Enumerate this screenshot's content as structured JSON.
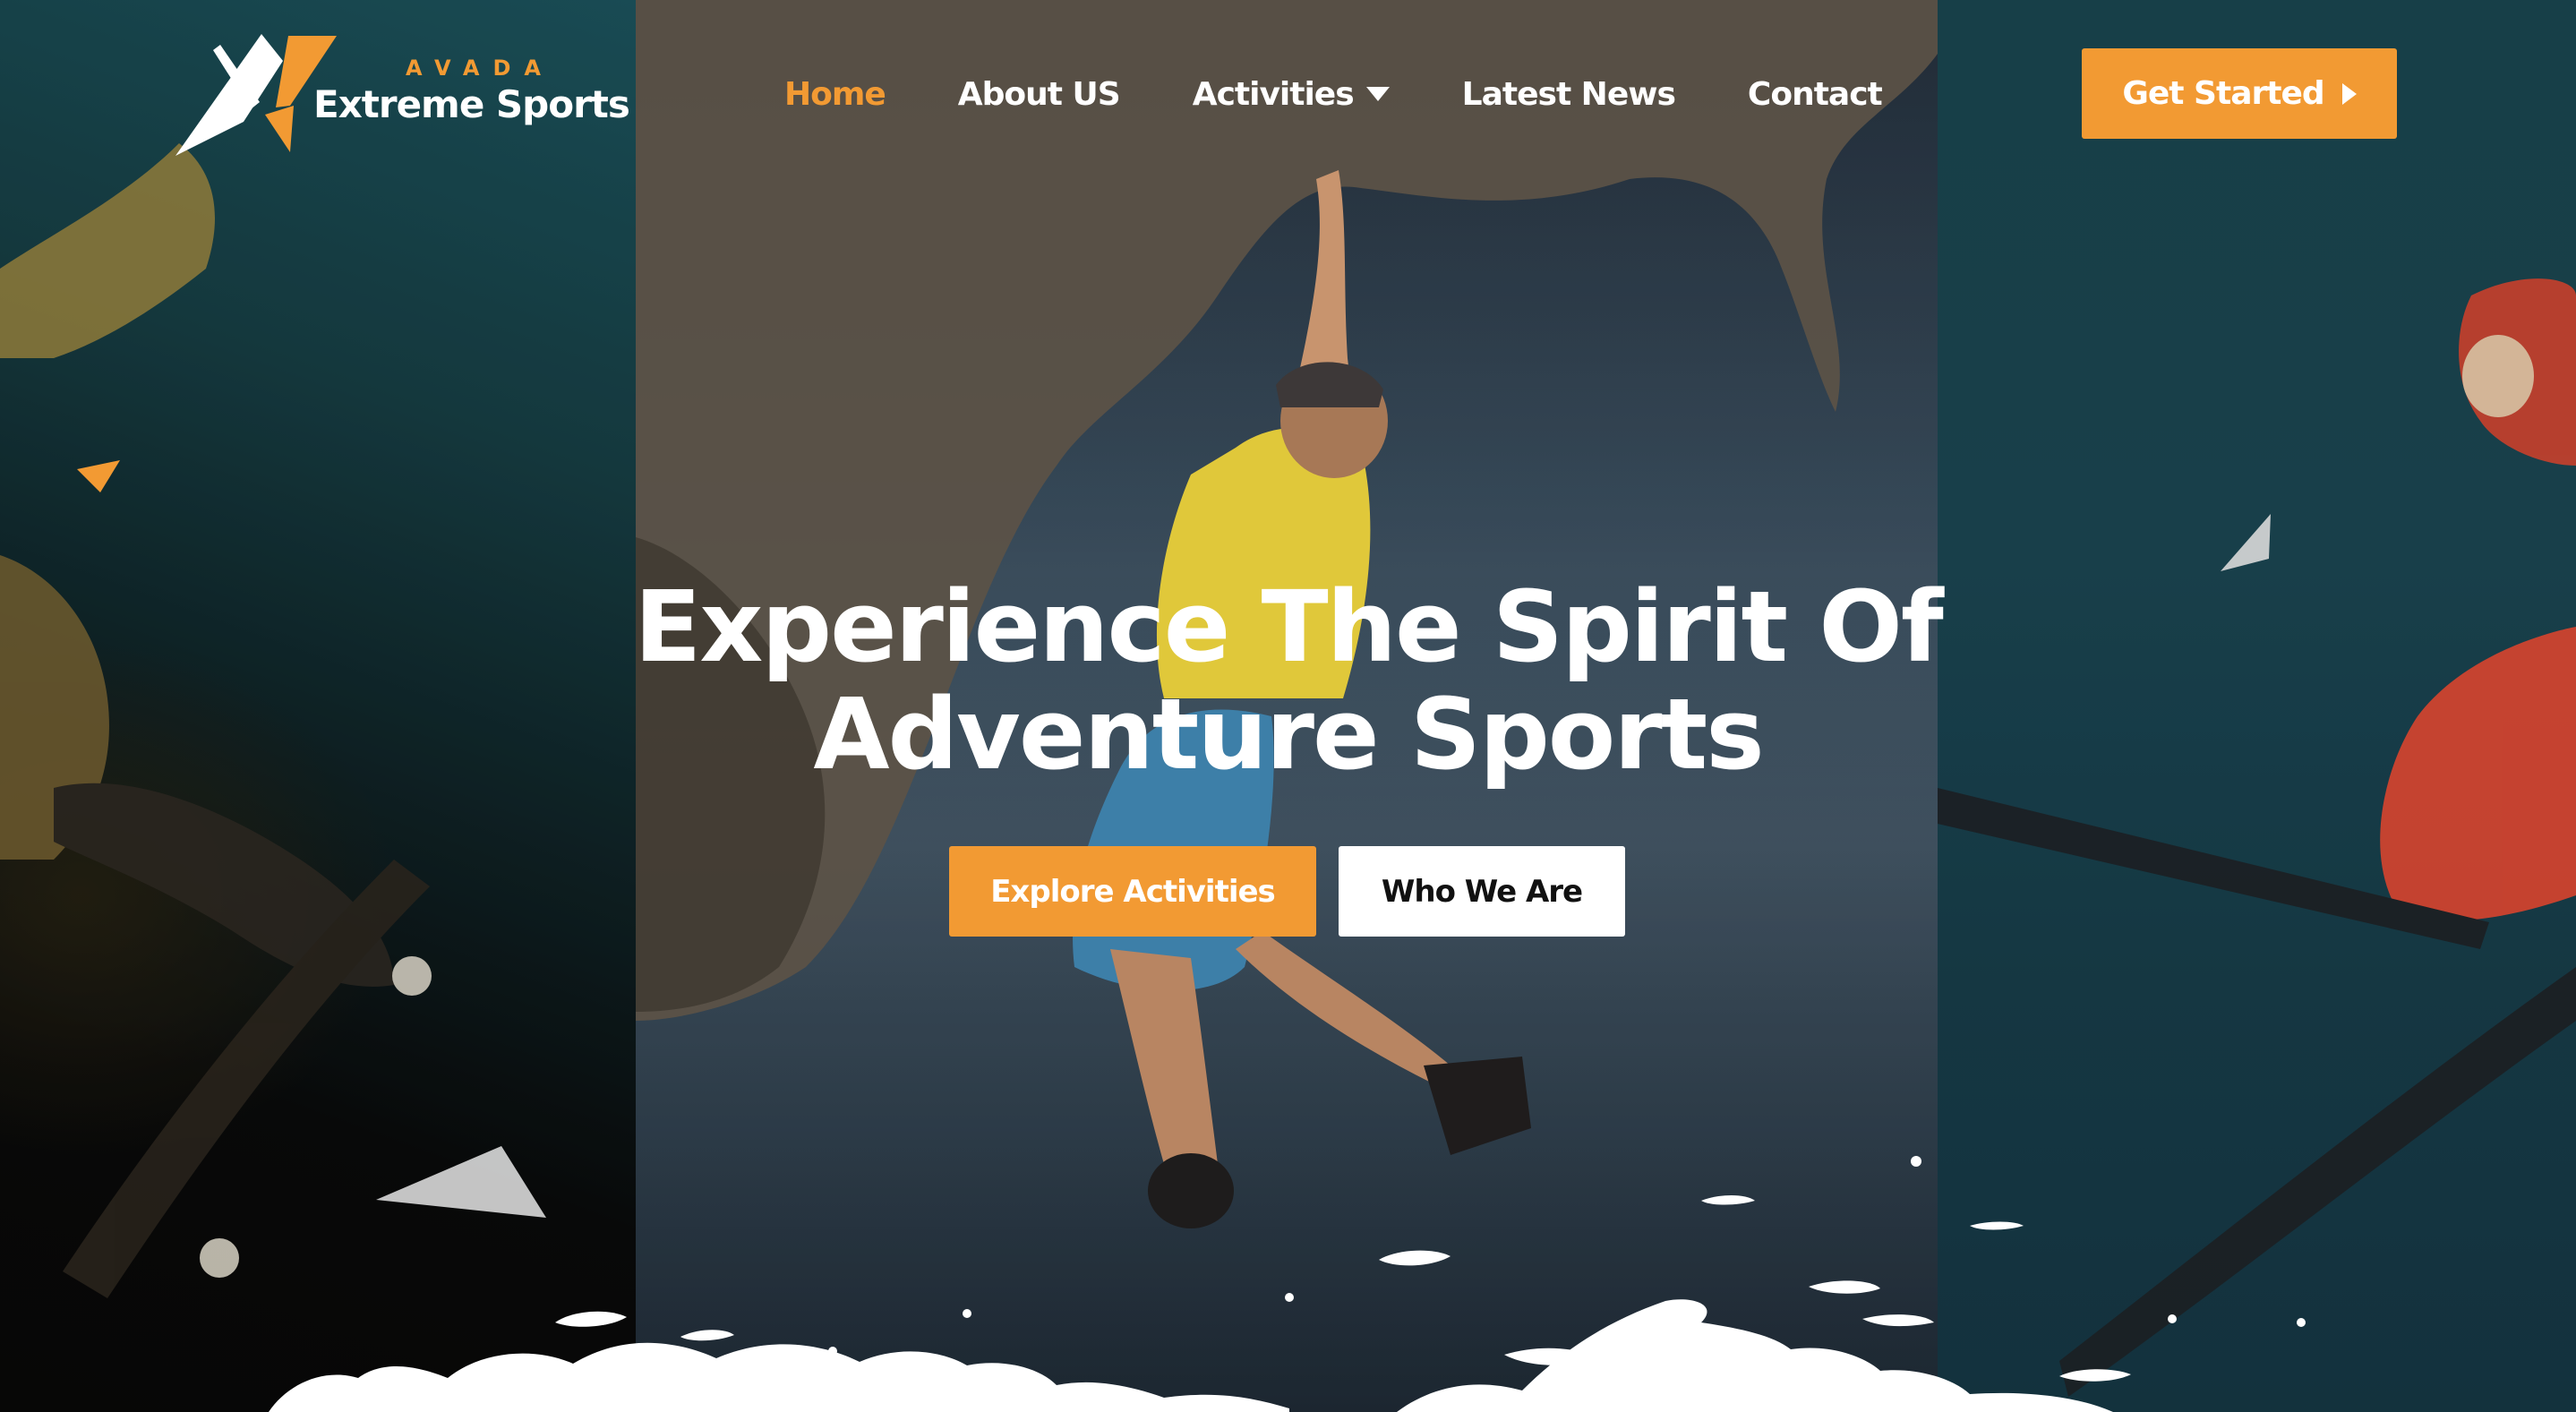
{
  "brand": {
    "tagline": "AVADA",
    "name": "Extreme Sports",
    "accent_color": "#f29a33"
  },
  "nav": {
    "items": [
      {
        "label": "Home",
        "active": true
      },
      {
        "label": "About US",
        "active": false
      },
      {
        "label": "Activities",
        "active": false,
        "has_dropdown": true
      },
      {
        "label": "Latest News",
        "active": false
      },
      {
        "label": "Contact",
        "active": false
      }
    ],
    "dropdown_icon": "caret-down-icon"
  },
  "header_cta": {
    "label": "Get Started",
    "icon": "caret-right-icon"
  },
  "hero": {
    "title_line1": "Experience The Spirit Of",
    "title_line2": "Adventure Sports",
    "primary_button": "Explore Activities",
    "secondary_button": "Who We Are"
  },
  "background": {
    "panels": [
      "skateboarder",
      "rock-climber",
      "skier"
    ]
  }
}
